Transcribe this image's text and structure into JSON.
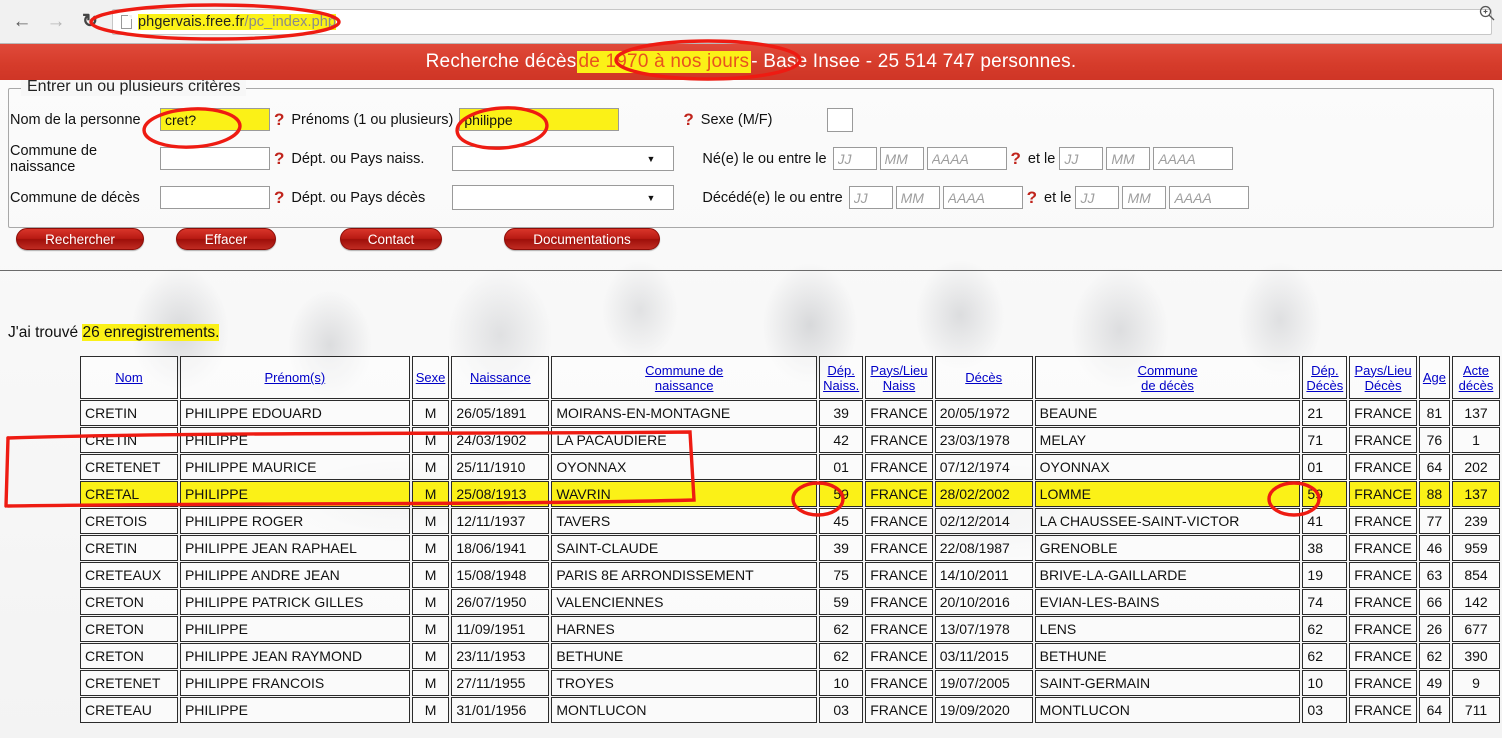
{
  "browser": {
    "back_icon": "back-arrow-icon",
    "forward_icon": "forward-arrow-icon",
    "reload_icon": "reload-icon",
    "url_domain": "phgervais.free.fr",
    "url_path": "/pc_index.php",
    "zoom_icon": "magnifier-icon"
  },
  "banner": {
    "part1": "Recherche décès ",
    "highlight": "de 1970 à nos jours",
    "part2": " - Base Insee - 25 514 747 personnes."
  },
  "criteria": {
    "legend": "Entrer un ou plusieurs critères",
    "nom_label": "Nom de la personne",
    "nom_value": "cret?",
    "prenoms_label": "Prénoms (1 ou plusieurs)",
    "prenoms_value": "philippe",
    "sexe_label": "Sexe (M/F)",
    "sexe_value": "",
    "commune_naissance_label": "Commune de naissance",
    "commune_naissance_value": "",
    "dept_naiss_label": "Dépt. ou Pays naiss.",
    "dept_naiss_value": "",
    "ne_label": "Né(e) le ou entre le",
    "commune_deces_label": "Commune de décès",
    "commune_deces_value": "",
    "dept_deces_label": "Dépt. ou Pays décès",
    "dept_deces_value": "",
    "decede_label": "Décédé(e) le ou entre",
    "et_le_label": "et le",
    "ph_jj": "JJ",
    "ph_mm": "MM",
    "ph_aaaa": "AAAA",
    "help_icon": "question-mark-icon"
  },
  "buttons": {
    "rechercher": "Rechercher",
    "effacer": "Effacer",
    "contact": "Contact",
    "documentations": "Documentations"
  },
  "results": {
    "found_prefix": "J'ai trouvé ",
    "found_count": "26 enregistrements.",
    "columns": [
      "Nom",
      "Prénom(s)",
      "Sexe",
      "Naissance",
      "Commune de naissance",
      "Dép. Naiss.",
      "Pays/Lieu Naiss",
      "Décès",
      "Commune de décès",
      "Dép. Décès",
      "Pays/Lieu Décès",
      "Age",
      "Acte décès"
    ],
    "columns_multiline": [
      [
        "Nom"
      ],
      [
        "Prénom(s)"
      ],
      [
        "Sexe"
      ],
      [
        "Naissance"
      ],
      [
        "Commune de",
        "naissance"
      ],
      [
        "Dép.",
        "Naiss."
      ],
      [
        "Pays/Lieu",
        "Naiss"
      ],
      [
        "Décès"
      ],
      [
        "Commune",
        "de décès"
      ],
      [
        "Dép.",
        "Décès"
      ],
      [
        "Pays/Lieu",
        "Décès"
      ],
      [
        "Age"
      ],
      [
        "Acte",
        "décès"
      ]
    ],
    "rows": [
      {
        "nom": "CRETIN",
        "prenoms": "PHILIPPE EDOUARD",
        "sexe": "M",
        "naissance": "26/05/1891",
        "commune_naissance": "MOIRANS-EN-MONTAGNE",
        "dep_naiss": "39",
        "pays_naiss": "FRANCE",
        "deces": "20/05/1972",
        "commune_deces": "BEAUNE",
        "dep_deces": "21",
        "pays_deces": "FRANCE",
        "age": "81",
        "acte": "137",
        "highlight": false
      },
      {
        "nom": "CRETIN",
        "prenoms": "PHILIPPE",
        "sexe": "M",
        "naissance": "24/03/1902",
        "commune_naissance": "LA PACAUDIERE",
        "dep_naiss": "42",
        "pays_naiss": "FRANCE",
        "deces": "23/03/1978",
        "commune_deces": "MELAY",
        "dep_deces": "71",
        "pays_deces": "FRANCE",
        "age": "76",
        "acte": "1",
        "highlight": false
      },
      {
        "nom": "CRETENET",
        "prenoms": "PHILIPPE MAURICE",
        "sexe": "M",
        "naissance": "25/11/1910",
        "commune_naissance": "OYONNAX",
        "dep_naiss": "01",
        "pays_naiss": "FRANCE",
        "deces": "07/12/1974",
        "commune_deces": "OYONNAX",
        "dep_deces": "01",
        "pays_deces": "FRANCE",
        "age": "64",
        "acte": "202",
        "highlight": false
      },
      {
        "nom": "CRETAL",
        "prenoms": "PHILIPPE",
        "sexe": "M",
        "naissance": "25/08/1913",
        "commune_naissance": "WAVRIN",
        "dep_naiss": "59",
        "pays_naiss": "FRANCE",
        "deces": "28/02/2002",
        "commune_deces": "LOMME",
        "dep_deces": "59",
        "pays_deces": "FRANCE",
        "age": "88",
        "acte": "137",
        "highlight": true
      },
      {
        "nom": "CRETOIS",
        "prenoms": "PHILIPPE ROGER",
        "sexe": "M",
        "naissance": "12/11/1937",
        "commune_naissance": "TAVERS",
        "dep_naiss": "45",
        "pays_naiss": "FRANCE",
        "deces": "02/12/2014",
        "commune_deces": "LA CHAUSSEE-SAINT-VICTOR",
        "dep_deces": "41",
        "pays_deces": "FRANCE",
        "age": "77",
        "acte": "239",
        "highlight": false
      },
      {
        "nom": "CRETIN",
        "prenoms": "PHILIPPE JEAN RAPHAEL",
        "sexe": "M",
        "naissance": "18/06/1941",
        "commune_naissance": "SAINT-CLAUDE",
        "dep_naiss": "39",
        "pays_naiss": "FRANCE",
        "deces": "22/08/1987",
        "commune_deces": "GRENOBLE",
        "dep_deces": "38",
        "pays_deces": "FRANCE",
        "age": "46",
        "acte": "959",
        "highlight": false
      },
      {
        "nom": "CRETEAUX",
        "prenoms": "PHILIPPE ANDRE JEAN",
        "sexe": "M",
        "naissance": "15/08/1948",
        "commune_naissance": "PARIS 8E ARRONDISSEMENT",
        "dep_naiss": "75",
        "pays_naiss": "FRANCE",
        "deces": "14/10/2011",
        "commune_deces": "BRIVE-LA-GAILLARDE",
        "dep_deces": "19",
        "pays_deces": "FRANCE",
        "age": "63",
        "acte": "854",
        "highlight": false
      },
      {
        "nom": "CRETON",
        "prenoms": "PHILIPPE PATRICK GILLES",
        "sexe": "M",
        "naissance": "26/07/1950",
        "commune_naissance": "VALENCIENNES",
        "dep_naiss": "59",
        "pays_naiss": "FRANCE",
        "deces": "20/10/2016",
        "commune_deces": "EVIAN-LES-BAINS",
        "dep_deces": "74",
        "pays_deces": "FRANCE",
        "age": "66",
        "acte": "142",
        "highlight": false
      },
      {
        "nom": "CRETON",
        "prenoms": "PHILIPPE",
        "sexe": "M",
        "naissance": "11/09/1951",
        "commune_naissance": "HARNES",
        "dep_naiss": "62",
        "pays_naiss": "FRANCE",
        "deces": "13/07/1978",
        "commune_deces": "LENS",
        "dep_deces": "62",
        "pays_deces": "FRANCE",
        "age": "26",
        "acte": "677",
        "highlight": false
      },
      {
        "nom": "CRETON",
        "prenoms": "PHILIPPE JEAN RAYMOND",
        "sexe": "M",
        "naissance": "23/11/1953",
        "commune_naissance": "BETHUNE",
        "dep_naiss": "62",
        "pays_naiss": "FRANCE",
        "deces": "03/11/2015",
        "commune_deces": "BETHUNE",
        "dep_deces": "62",
        "pays_deces": "FRANCE",
        "age": "62",
        "acte": "390",
        "highlight": false
      },
      {
        "nom": "CRETENET",
        "prenoms": "PHILIPPE FRANCOIS",
        "sexe": "M",
        "naissance": "27/11/1955",
        "commune_naissance": "TROYES",
        "dep_naiss": "10",
        "pays_naiss": "FRANCE",
        "deces": "19/07/2005",
        "commune_deces": "SAINT-GERMAIN",
        "dep_deces": "10",
        "pays_deces": "FRANCE",
        "age": "49",
        "acte": "9",
        "highlight": false
      },
      {
        "nom": "CRETEAU",
        "prenoms": "PHILIPPE",
        "sexe": "M",
        "naissance": "31/01/1956",
        "commune_naissance": "MONTLUCON",
        "dep_naiss": "03",
        "pays_naiss": "FRANCE",
        "deces": "19/09/2020",
        "commune_deces": "MONTLUCON",
        "dep_deces": "03",
        "pays_deces": "FRANCE",
        "age": "64",
        "acte": "711",
        "highlight": false
      }
    ]
  },
  "colors": {
    "banner_red": "#d63c2b",
    "highlight_yellow": "#fbf117",
    "annotation_red": "#ee1b12",
    "link_blue": "#0000c8"
  }
}
